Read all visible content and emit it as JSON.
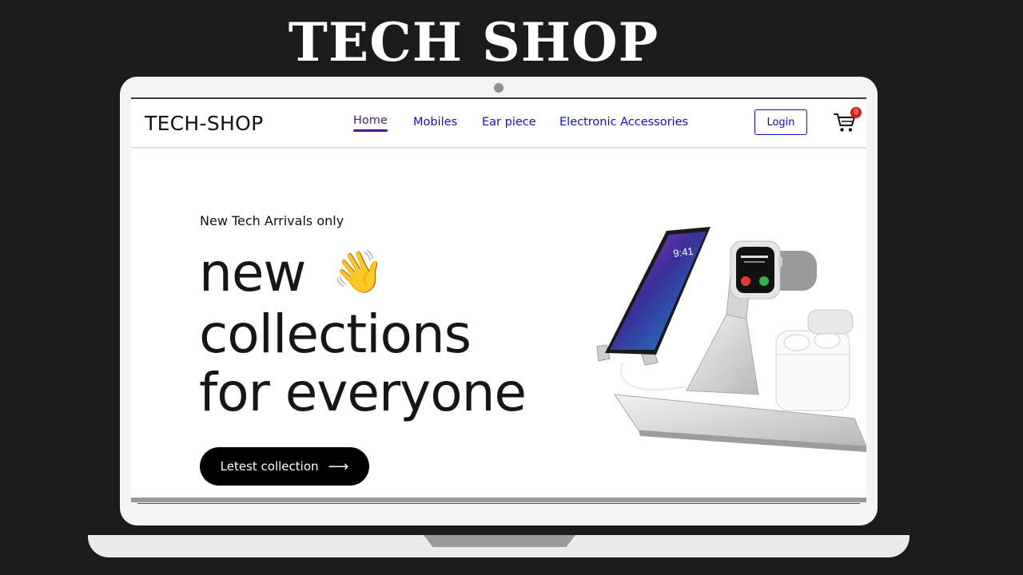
{
  "poster": {
    "title": "TECH SHOP"
  },
  "navbar": {
    "logo": "TECH-SHOP",
    "links": [
      {
        "label": "Home",
        "active": true
      },
      {
        "label": "Mobiles",
        "active": false
      },
      {
        "label": "Ear piece",
        "active": false
      },
      {
        "label": "Electronic Accessories",
        "active": false
      }
    ],
    "login_label": "Login",
    "cart_count": "0"
  },
  "hero": {
    "kicker": "New Tech Arrivals only",
    "headline_line1": "new",
    "headline_emoji": "👋",
    "headline_line2": "collections",
    "headline_line3": "for everyone",
    "cta_label": "Letest collection",
    "cta_arrow": "⟶"
  },
  "product_image": {
    "phone_time": "9:41",
    "icons": [
      "charging-stand",
      "smartphone",
      "smartwatch",
      "earbuds-case"
    ]
  },
  "colors": {
    "page_background": "#1b1b1b",
    "nav_link": "#1010c8",
    "nav_active": "#4a1a8c",
    "cart_badge": "#e01818",
    "cta_background": "#000000"
  }
}
